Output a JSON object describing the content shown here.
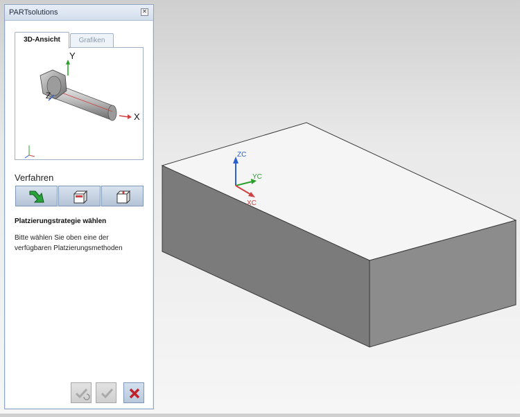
{
  "panel": {
    "title": "PARTsolutions",
    "close_glyph": "✕",
    "tabs": [
      {
        "label": "3D-Ansicht",
        "active": true
      },
      {
        "label": "Grafiken",
        "active": false
      }
    ],
    "preview": {
      "axis_y": "Y",
      "axis_z": "Z",
      "axis_x": "X"
    },
    "section_label": "Verfahren",
    "tools": [
      {
        "icon": "green-arrow-icon"
      },
      {
        "icon": "box-front-face-icon"
      },
      {
        "icon": "box-top-face-icon"
      }
    ],
    "heading": "Platzierungstrategie wählen",
    "description": [
      "Bitte wählen Sie oben eine der",
      "verfügbaren Platzierungsmethoden"
    ],
    "buttons": [
      {
        "icon": "apply-check-icon",
        "enabled": false
      },
      {
        "icon": "check-icon",
        "enabled": false
      },
      {
        "icon": "cancel-x-icon",
        "enabled": true
      }
    ]
  },
  "viewport": {
    "axis_zc": "ZC",
    "axis_yc": "YC",
    "axis_xc": "XC"
  },
  "colors": {
    "panel_border": "#8fa6c6",
    "tool_button": "#b4c3d6",
    "cancel_x": "#c0202a",
    "axis_z": "#2a5fd0",
    "axis_y": "#2ba02b",
    "axis_x": "#d04040"
  }
}
